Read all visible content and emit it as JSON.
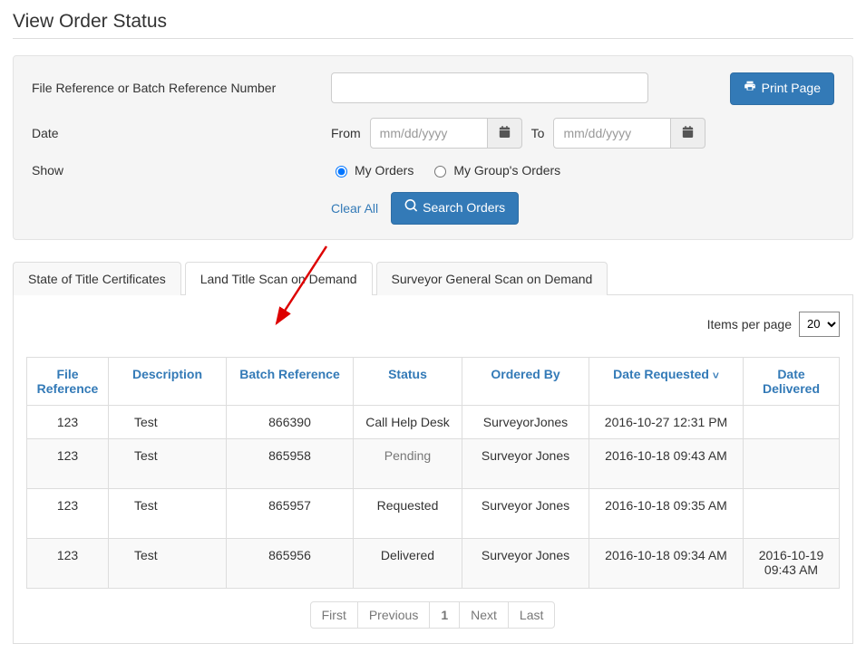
{
  "page": {
    "title": "View Order Status"
  },
  "filters": {
    "labels": {
      "file_ref": "File Reference or Batch Reference Number",
      "date": "Date",
      "from": "From",
      "to": "To",
      "show": "Show"
    },
    "file_ref_value": "",
    "date_from_placeholder": "mm/dd/yyyy",
    "date_to_placeholder": "mm/dd/yyyy",
    "show_options": {
      "my_orders": "My Orders",
      "group_orders": "My Group's Orders"
    },
    "clear_all": "Clear All",
    "search": "Search Orders",
    "print": "Print Page"
  },
  "tabs": {
    "t0": "State of Title Certificates",
    "t1": "Land Title Scan on Demand",
    "t2": "Surveyor General Scan on Demand"
  },
  "ipp": {
    "label": "Items per page",
    "value": "20"
  },
  "columns": {
    "file_ref": "File Reference",
    "desc": "Description",
    "batch": "Batch Reference",
    "status": "Status",
    "ordered_by": "Ordered By",
    "date_req": "Date Requested",
    "date_del": "Date Delivered"
  },
  "rows": [
    {
      "file_ref": "123",
      "desc": "Test",
      "batch": "866390",
      "status": "Call Help Desk",
      "ordered_by": "SurveyorJones",
      "date_req": "2016-10-27 12:31 PM",
      "date_del": ""
    },
    {
      "file_ref": "123",
      "desc": "Test",
      "batch": "865958",
      "status": "Pending",
      "ordered_by": "Surveyor Jones",
      "date_req": "2016-10-18 09:43 AM",
      "date_del": ""
    },
    {
      "file_ref": "123",
      "desc": "Test",
      "batch": "865957",
      "status": "Requested",
      "ordered_by": "Surveyor Jones",
      "date_req": "2016-10-18 09:35 AM",
      "date_del": ""
    },
    {
      "file_ref": "123",
      "desc": "Test",
      "batch": "865956",
      "status": "Delivered",
      "ordered_by": "Surveyor Jones",
      "date_req": "2016-10-18 09:34 AM",
      "date_del": "2016-10-19 09:43 AM"
    }
  ],
  "pager": {
    "first": "First",
    "prev": "Previous",
    "page": "1",
    "next": "Next",
    "last": "Last"
  }
}
